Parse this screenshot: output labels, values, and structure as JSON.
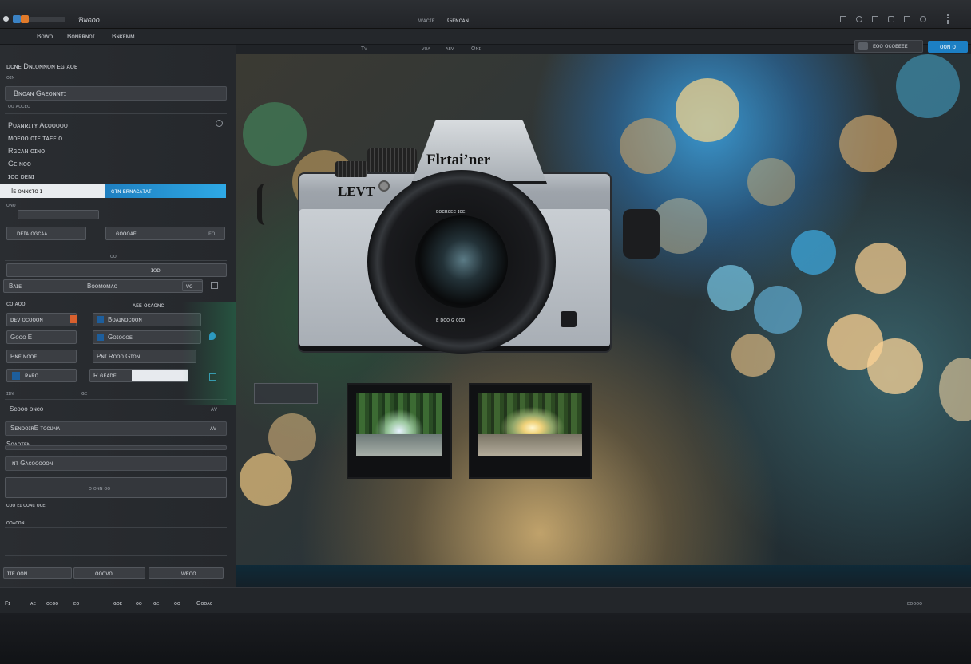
{
  "titlebar": {
    "app_name": "Ɓɴɢᴏᴏ",
    "center_a": "ᴡᴀᴄɪᴇ",
    "center_b": "Gᴇɴᴄᴀɴ"
  },
  "menubar": {
    "items": [
      "Bᴏᴡᴏ",
      "Boɴʀʀɴᴏɪ",
      "Bɴᴋᴇᴍᴍ"
    ],
    "tabs": [
      "Tv",
      "ᴠᴏᴀ",
      "ᴀᴇᴠ",
      "Oɴɪ"
    ]
  },
  "left_panel": {
    "header": "ᴅᴄɴᴇ Dɴɪᴏɴɴᴏɴ ᴇɢ ᴀᴏᴇ",
    "subheader": "ᴏɪɴ",
    "field1": "Bɴᴏᴀɴ Gᴀᴇᴏɴɴᴛɪ",
    "field1_small": "ᴏᴜ ᴀᴏᴄᴇᴄ",
    "list": [
      "Pᴏᴀɴʀɪᴛʏ Aᴄᴏᴏᴏᴏᴏ",
      "ᴍᴏᴇᴏᴏ ᴏɪᴇ ᴛᴀᴇᴇ ᴏ",
      "Rɢᴄᴀɴ ᴏɪɴᴏ",
      "Gᴇ ɴᴏᴏ",
      "ɪᴏᴏ ᴅᴇɴɪ"
    ],
    "selected_label": "Iᴇ ᴏɴɴᴄᴛᴏ ɪ",
    "selected_value": "ɢᴛɴ ᴇʀɴᴀᴄᴀᴛᴀᴛ",
    "small_row": "ᴏɴᴏ",
    "row_a_left": "ᴅᴇɪᴀ ᴏɢᴄᴀᴀ",
    "row_a_right": "ɢᴏᴏᴏᴀᴇ",
    "row_a_end": "ᴇᴏ",
    "mini": "ᴏᴏ",
    "row_b_mid": "ɪᴏᴅ",
    "row_c_left": "Bᴀɪᴇ",
    "row_c_mid": "Boᴏᴍᴏᴍᴀᴏ",
    "row_c_end": "ᴠᴏ",
    "label_left": "ᴄᴏ ᴀᴏᴏ",
    "label_right": "ᴀᴇᴇ ᴏᴄᴀᴏɴᴄ",
    "grid_left": [
      "ᴅᴇᴠ ᴏᴄᴏᴏᴏɴ",
      "Goᴏᴏ  E",
      "Pɴᴇ ɴᴏᴏᴇ",
      "ʀᴀʀᴏ"
    ],
    "grid_right": [
      "Bᴏᴀɪɴᴏᴄᴏᴏɴ",
      "Goɪᴏᴏᴏᴇ",
      "Pɴɪ Roᴏᴏ Gɪᴏɴ",
      "R ɢᴇᴀᴅᴇ"
    ],
    "after_grid_left": "ɪɪɴ",
    "after_grid_right": "ɢᴇ",
    "row_d": "Sᴄᴏᴏᴏ ᴏɴᴄᴏ",
    "row_d_end": "ᴀᴠ",
    "row_e": "SᴇɴᴏᴏɪʀE ᴛᴏᴄᴜɴᴀ",
    "row_e_end": "ᴀᴠ",
    "row_f": "Sᴏᴀᴏᴛᴇɴ",
    "row_g": "ɴᴛ Gᴀᴄᴏᴏᴏᴏᴏɴ",
    "row_h": "ᴏ ᴏɴɴ ᴏᴏ",
    "row_i": "ᴄᴏᴏ ᴇɪ ᴏᴏᴀᴄ ᴏᴄᴇ",
    "row_j": "ᴏᴏᴀᴄᴏɴ",
    "row_k": "—",
    "footer": [
      "ɪɪᴇ ᴏᴏɴ",
      "ᴏᴏᴏᴠᴏ",
      "ᴡᴇᴏᴏ"
    ]
  },
  "viewer": {
    "camera_brand": "Flrtaiʼner",
    "camera_model": "LEVT",
    "lens_top": "ᴇᴏᴄʀᴄᴇᴄ ɪᴄᴇ",
    "lens_bottom": "ᴇ ᴅᴏᴏ ɢ ᴄᴏᴏ",
    "btn_dark": "ᴇᴏᴏ ᴏᴄᴏᴇᴇᴇᴇ",
    "btn_blue": "ᴏᴏɴ ᴏ"
  },
  "statusbar": {
    "items": [
      "Fɪ",
      "ᴀᴇ",
      "ᴏᴇᴏᴏ",
      "ᴇᴏ",
      "ɢᴏᴇ",
      "ᴏᴏ",
      "ɢᴇ",
      "ᴏᴏ",
      "Gᴏᴏᴀᴄ"
    ],
    "right": "ᴇᴏᴏᴏᴏ"
  }
}
